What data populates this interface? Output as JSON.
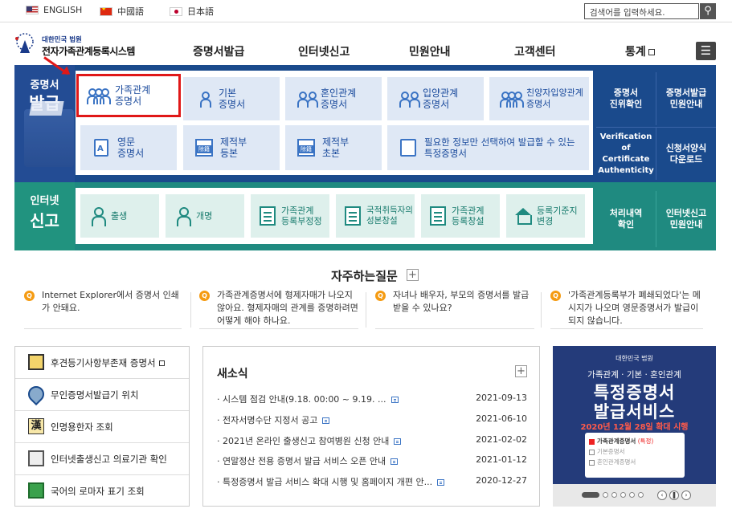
{
  "langs": [
    "ENGLISH",
    "中國語",
    "日本語"
  ],
  "search": {
    "placeholder": "검색어를 입력하세요."
  },
  "logo": {
    "small": "대한민국 법원",
    "title": "전자가족관계등록시스템"
  },
  "gnb": [
    "증명서발급",
    "인터넷신고",
    "민원안내",
    "고객센터",
    "통계"
  ],
  "issue": {
    "label1": "증명서",
    "label2": "발급",
    "cards": [
      {
        "l1": "가족관계",
        "l2": "증명서"
      },
      {
        "l1": "기본",
        "l2": "증명서"
      },
      {
        "l1": "혼인관계",
        "l2": "증명서"
      },
      {
        "l1": "입양관계",
        "l2": "증명서"
      },
      {
        "l1": "친양자입양관계",
        "l2": "증명서"
      },
      {
        "l1": "영문",
        "l2": "증명서"
      },
      {
        "l1": "제적부",
        "l2": "등본"
      },
      {
        "l1": "제적부",
        "l2": "초본"
      },
      {
        "l1": "필요한 정보만 선택하여 발급할 수 있는",
        "l2": "특정증명서"
      }
    ],
    "doc_icon_letters": [
      "A",
      "除籍",
      "除籍"
    ],
    "side": [
      {
        "l1": "증명서",
        "l2": "진위확인"
      },
      {
        "l1": "증명서발급",
        "l2": "민원안내"
      },
      {
        "l1": "Verification of",
        "l2": "Certificate",
        "l3": "Authenticity"
      },
      {
        "l1": "신청서양식",
        "l2": "다운로드"
      }
    ]
  },
  "report": {
    "label1": "인터넷",
    "label2": "신고",
    "cards": [
      {
        "l1": "출생",
        "l2": ""
      },
      {
        "l1": "개명",
        "l2": ""
      },
      {
        "l1": "가족관계",
        "l2": "등록부정정"
      },
      {
        "l1": "국적취득자의",
        "l2": "성본창설"
      },
      {
        "l1": "가족관계",
        "l2": "등록창설"
      },
      {
        "l1": "등록기준지",
        "l2": "변경"
      }
    ],
    "side": [
      {
        "l1": "처리내역",
        "l2": "확인"
      },
      {
        "l1": "인터넷신고",
        "l2": "민원안내"
      }
    ]
  },
  "faq": {
    "title": "자주하는질문",
    "items": [
      "Internet Explorer에서 증명서 인쇄가 안돼요.",
      "가족관계증명서에 형제자매가 나오지 않아요. 형제자매의 관계를 증명하려면 어떻게 해야 하나요.",
      "자녀나 배우자, 부모의 증명서를 발급 받을 수 있나요?",
      "'가족관계등록부가 폐쇄되었다'는 메시지가 나오며 영문증명서가 발급이 되지 않습니다."
    ]
  },
  "quick": [
    "후견등기사항부존재 증명서",
    "무인증명서발급기 위치",
    "인명용한자 조회",
    "인터넷출생신고 의료기관 확인",
    "국어의 로마자 표기 조회"
  ],
  "quick_icon_letter": "漢",
  "news": {
    "title": "새소식",
    "items": [
      {
        "title": "시스템 점검 안내(9.18. 00:00 ~ 9.19. ...",
        "date": "2021-09-13"
      },
      {
        "title": "전자서명수단 지정서 공고",
        "date": "2021-06-10"
      },
      {
        "title": "2021년 온라인 출생신고 참여병원 신청 안내",
        "date": "2021-02-02"
      },
      {
        "title": "연말정산 전용 증명서 발급 서비스 오픈 안내",
        "date": "2021-01-12"
      },
      {
        "title": "특정증명서 발급 서비스 확대 시행 및 홈페이지 개편 안...",
        "date": "2020-12-27"
      }
    ]
  },
  "banner": {
    "brand": "대한민국 법원",
    "sub": "가족관계 · 기본 · 혼인관계",
    "t1": "특정증명서",
    "t2": "발급서비스",
    "red": "2020년 12월 28일 확대 시행",
    "opt1": "가족관계증명서",
    "opt1_tag": "(특정)",
    "opt2": "기본증명서",
    "opt3": "혼인관계증명서"
  },
  "colors": {
    "issue_bg": "#1a4a8c",
    "report_bg": "#1f8a80",
    "highlight": "#e01818",
    "faq_icon": "#f59b12"
  }
}
